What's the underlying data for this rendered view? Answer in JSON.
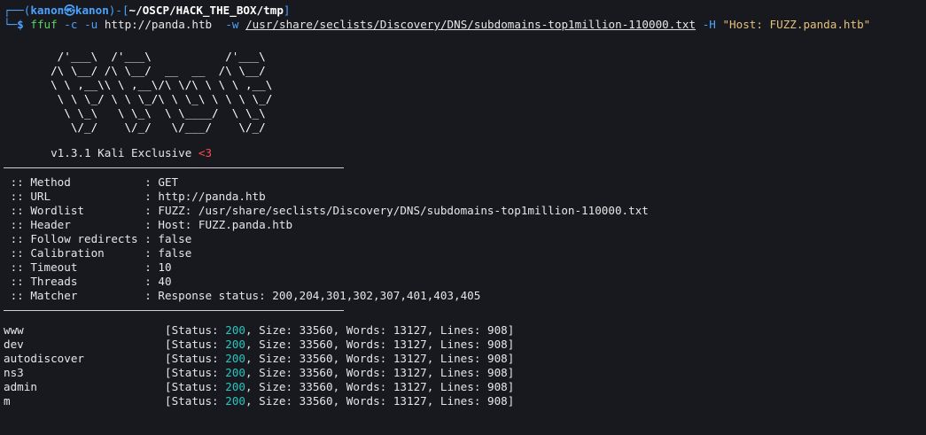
{
  "prompt": {
    "top": "┌──(kanon㉿kanon)-[~/OSCP/HACK_THE_BOX/tmp]",
    "top_open": "┌──(",
    "user": "kanon",
    "sym": "㉿",
    "host": "kanon",
    "mid": ")-[",
    "cwd": "~/OSCP/HACK_THE_BOX/tmp",
    "end": "]",
    "bottom": "└─",
    "dollar": "$",
    "command": "ffuf",
    "opt_c": "-c",
    "opt_u": "-u",
    "url": "http://panda.htb",
    "opt_w": "-w",
    "wordlist_path": "/usr/share/seclists/Discovery/DNS/subdomains-top1million-110000.txt",
    "opt_h": "-H",
    "header_arg": "\"Host: FUZZ.panda.htb\""
  },
  "banner": {
    "ascii": [
      "        /'___\\  /'___\\           /'___\\       ",
      "       /\\ \\__/ /\\ \\__/  __  __  /\\ \\__/       ",
      "       \\ \\ ,__\\\\ \\ ,__\\/\\ \\/\\ \\ \\ \\ ,__\\      ",
      "        \\ \\ \\_/ \\ \\ \\_/\\ \\ \\_\\ \\ \\ \\ \\_/      ",
      "         \\ \\_\\   \\ \\_\\  \\ \\____/  \\ \\_\\       ",
      "          \\/_/    \\/_/   \\/___/    \\/_/       "
    ],
    "version": "       v1.3.1 Kali Exclusive ",
    "heart": "<3"
  },
  "config": [
    {
      "key": " :: Method           : ",
      "value": "GET"
    },
    {
      "key": " :: URL              : ",
      "value": "http://panda.htb"
    },
    {
      "key": " :: Wordlist         : ",
      "value": "FUZZ: /usr/share/seclists/Discovery/DNS/subdomains-top1million-110000.txt"
    },
    {
      "key": " :: Header           : ",
      "value": "Host: FUZZ.panda.htb"
    },
    {
      "key": " :: Follow redirects : ",
      "value": "false"
    },
    {
      "key": " :: Calibration      : ",
      "value": "false"
    },
    {
      "key": " :: Timeout          : ",
      "value": "10"
    },
    {
      "key": " :: Threads          : ",
      "value": "40"
    },
    {
      "key": " :: Matcher          : ",
      "value": "Response status: 200,204,301,302,307,401,403,405"
    }
  ],
  "results": [
    {
      "name": "www",
      "pad": "                     ",
      "status": "200",
      "size": "33560",
      "words": "13127",
      "lines": "908"
    },
    {
      "name": "dev",
      "pad": "                     ",
      "status": "200",
      "size": "33560",
      "words": "13127",
      "lines": "908"
    },
    {
      "name": "autodiscover",
      "pad": "            ",
      "status": "200",
      "size": "33560",
      "words": "13127",
      "lines": "908"
    },
    {
      "name": "ns3",
      "pad": "                     ",
      "status": "200",
      "size": "33560",
      "words": "13127",
      "lines": "908"
    },
    {
      "name": "admin",
      "pad": "                   ",
      "status": "200",
      "size": "33560",
      "words": "13127",
      "lines": "908"
    },
    {
      "name": "m",
      "pad": "                       ",
      "status": "200",
      "size": "33560",
      "words": "13127",
      "lines": "908"
    }
  ],
  "result_fmt": {
    "open": "[Status: ",
    "size_lbl": ", Size: ",
    "words_lbl": ", Words: ",
    "lines_lbl": ", Lines: ",
    "close": "]"
  }
}
